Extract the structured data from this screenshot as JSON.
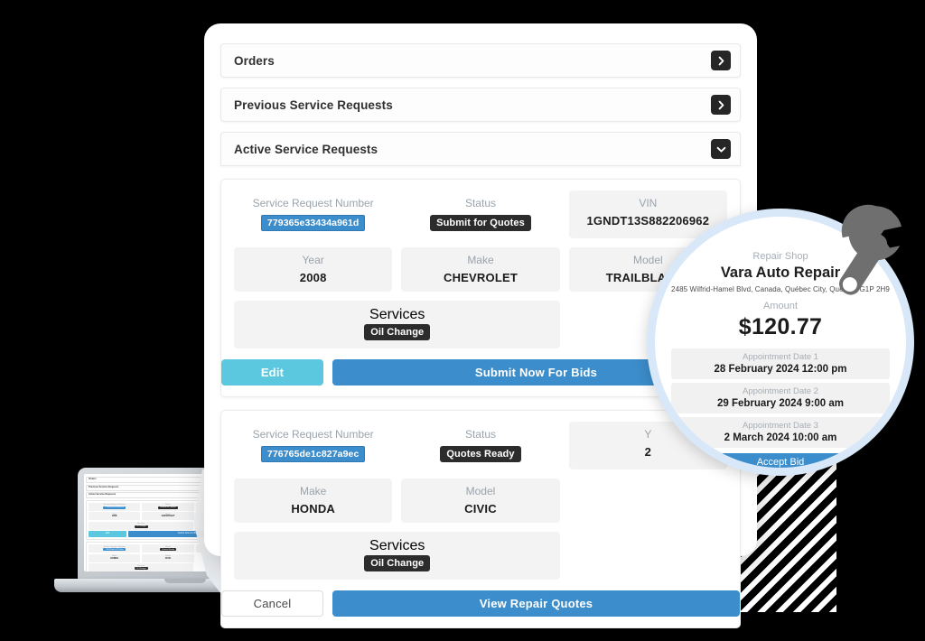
{
  "accordions": [
    {
      "title": "Orders",
      "icon": "chevron-right-icon",
      "expanded": false
    },
    {
      "title": "Previous Service Requests",
      "icon": "chevron-right-icon",
      "expanded": false
    },
    {
      "title": "Active Service Requests",
      "icon": "chevron-down-icon",
      "expanded": true
    }
  ],
  "requests": [
    {
      "sr_label": "Service Request Number",
      "sr_value": "779365e33434a961d",
      "status_label": "Status",
      "status_value": "Submit for Quotes",
      "vin_label": "VIN",
      "vin_value": "1GNDT13S882206962",
      "year_label": "Year",
      "year_value": "2008",
      "make_label": "Make",
      "make_value": "CHEVROLET",
      "model_label": "Model",
      "model_value": "TRAILBLAZER",
      "services_label": "Services",
      "services_value": "Oil Change",
      "primary_button": "Submit Now For Bids",
      "secondary_button": "Edit"
    },
    {
      "sr_label": "Service Request Number",
      "sr_value": "776765de1c827a9ec",
      "status_label": "Status",
      "status_value": "Quotes Ready",
      "year_label": "Y",
      "year_value": "2",
      "make_label": "Make",
      "make_value": "HONDA",
      "model_label": "Model",
      "model_value": "CIVIC",
      "services_label": "Services",
      "services_value": "Oil Change",
      "primary_button": "View Repair Quotes",
      "secondary_button": "Cancel"
    }
  ],
  "magnifier": {
    "shop_label": "Repair Shop",
    "shop_name": "Vara Auto Repair",
    "shop_address": "2485 Wilfrid-Hamel Blvd, Canada, Québec City, Quebec, G1P 2H9",
    "amount_label": "Amount",
    "amount_value": "$120.77",
    "appointments": [
      {
        "label": "Appointment Date 1",
        "value": "28 February 2024 12:00 pm"
      },
      {
        "label": "Appointment Date 2",
        "value": "29 February 2024 9:00 am"
      },
      {
        "label": "Appointment Date 3",
        "value": "2 March 2024 10:00 am"
      }
    ],
    "accept_button": "Accept Bid",
    "icon": "wrench-icon"
  },
  "colors": {
    "primary_blue": "#3c8dcb",
    "accent_cyan": "#5bc8e0",
    "badge_dark": "#2c2c2c",
    "ring_blue": "#d9e8f8",
    "field_grey": "#f3f3f3"
  },
  "laptop": {
    "name": "laptop-mockup"
  }
}
